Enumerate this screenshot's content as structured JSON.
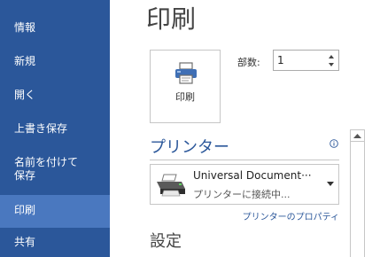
{
  "sidebar": {
    "items": [
      {
        "label": "情報"
      },
      {
        "label": "新規"
      },
      {
        "label": "開く"
      },
      {
        "label": "上書き保存"
      },
      {
        "label_line1": "名前を付けて",
        "label_line2": "保存"
      },
      {
        "label": "印刷",
        "active": true
      },
      {
        "label": "共有"
      }
    ]
  },
  "main": {
    "title": "印刷",
    "print_button_label": "印刷",
    "copies_label": "部数:",
    "copies_value": "1",
    "printer_section": {
      "heading": "プリンター",
      "info_icon": "info-icon",
      "printer_name": "Universal Document···",
      "printer_status": "プリンターに接続中...",
      "properties_link": "プリンターのプロパティ"
    },
    "settings_heading": "設定"
  },
  "colors": {
    "sidebar_bg": "#2b579a",
    "sidebar_active": "#4a78bf",
    "accent_text": "#2b579a",
    "border": "#c6c6c6"
  },
  "icons": {
    "print": "printer-icon",
    "printer_device": "printer-device-icon",
    "dropdown": "chevron-down-icon",
    "spin_up": "spin-up-icon",
    "spin_down": "spin-down-icon",
    "scroll_up": "scroll-up-arrow-icon"
  }
}
